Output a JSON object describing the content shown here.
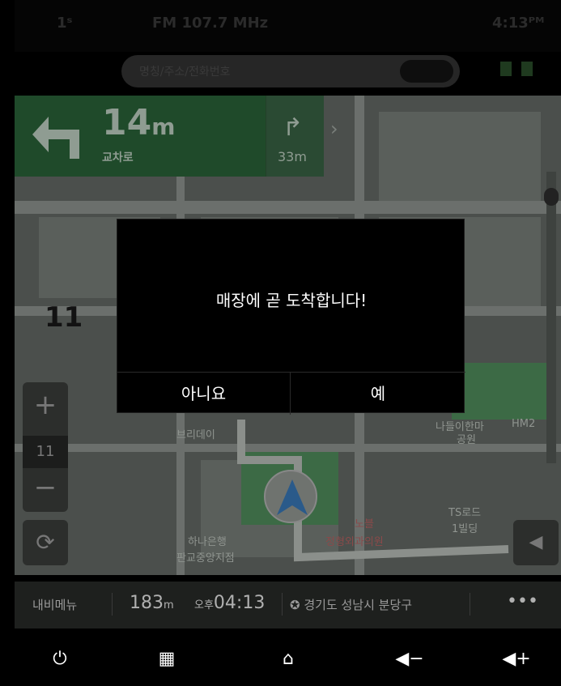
{
  "status": {
    "left": "1ˢ",
    "radio": "FM 107.7 MHz",
    "center": "",
    "time": "4:13ᴾᴹ"
  },
  "search": {
    "placeholder": "명칭/주소/전화번호"
  },
  "turn": {
    "distance": "14",
    "unit": "m",
    "cross": "교차로",
    "next_distance": "33m"
  },
  "map": {
    "speed_limit": "11",
    "zoom_level": "11",
    "labels": {
      "brewery": "브리데이",
      "park": "나들이한마",
      "park2": "공원",
      "hm": "HM2",
      "bank": "하나은행",
      "bank2": "판교중앙지점",
      "clinic": "노블",
      "clinic2": "정형외과의원",
      "ts": "TS로드",
      "ts2": "1빌딩"
    }
  },
  "dialog": {
    "message": "매장에 곧 도착합니다!",
    "no": "아니요",
    "yes": "예"
  },
  "info": {
    "menu": "내비메뉴",
    "distance": "183",
    "distance_unit": "m",
    "ampm": "오후",
    "arrival": "04:13",
    "address": "경기도 성남시 분당구",
    "more": "•••"
  },
  "colors": {
    "dialog_bg": "#000000",
    "turn_panel": "#1f4a2a",
    "map_bg": "#4b4f4c"
  }
}
